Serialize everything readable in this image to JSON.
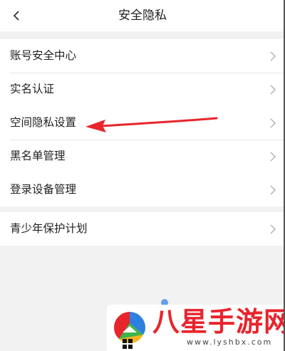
{
  "header": {
    "title": "安全隐私",
    "back_icon": "chevron-left-icon"
  },
  "groups": [
    {
      "items": [
        {
          "label": "账号安全中心"
        },
        {
          "label": "实名认证"
        }
      ]
    },
    {
      "items": [
        {
          "label": "空间隐私设置"
        },
        {
          "label": "黑名单管理"
        }
      ]
    },
    {
      "items": [
        {
          "label": "登录设备管理"
        }
      ]
    },
    {
      "items": [
        {
          "label": "青少年保护计划"
        }
      ]
    }
  ],
  "annotation": {
    "target": "空间隐私设置",
    "color": "#e8242c"
  },
  "watermark": {
    "title": "八星手游网",
    "url": "www.lyshbx.com",
    "color": "#e8242c"
  },
  "colors": {
    "background": "#f2f2f2",
    "surface": "#ffffff",
    "text": "#222222",
    "chevron": "#b3b3b3"
  }
}
